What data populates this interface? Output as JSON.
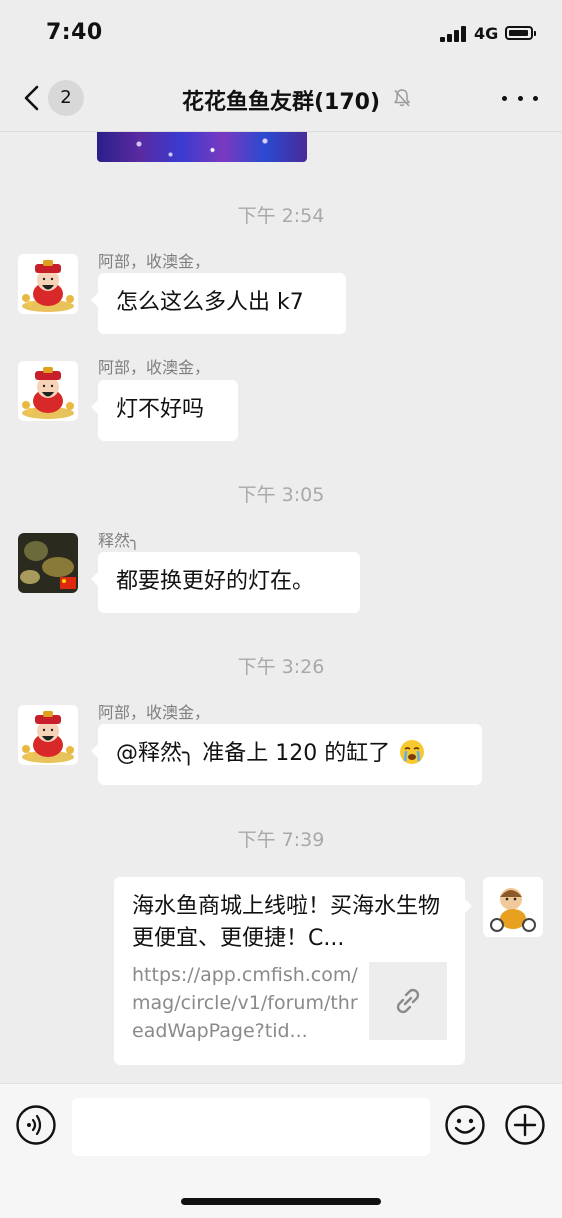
{
  "status_bar": {
    "time": "7:40",
    "network": "4G"
  },
  "nav": {
    "back_badge": "2",
    "title": "花花鱼鱼友群(170)"
  },
  "messages": [
    {
      "timestamp": "下午 2:54"
    },
    {
      "sender": "阿部，收澳金，",
      "text": "怎么这么多人出 k7"
    },
    {
      "sender": "阿部，收澳金，",
      "text": "灯不好吗"
    },
    {
      "timestamp": "下午 3:05"
    },
    {
      "sender": "释然╮",
      "text": "都要换更好的灯在。"
    },
    {
      "timestamp": "下午 3:26"
    },
    {
      "sender": "阿部，收澳金，",
      "text": "@释然╮  准备上 120 的缸了"
    },
    {
      "timestamp": "下午 7:39"
    },
    {
      "link_title": "海水鱼商城上线啦！买海水生物更便宜、更便捷！C...",
      "link_desc": "https://app.cmfish.com/mag/circle/v1/forum/threadWapPage?tid..."
    }
  ],
  "input": {
    "placeholder": ""
  },
  "colors": {
    "background": "#ededed",
    "bubble": "#ffffff",
    "timestamp": "#a9a9a9",
    "sender": "#7f7f7f"
  },
  "icons": [
    "back-icon",
    "mute-icon",
    "more-icon",
    "link-icon",
    "voice-icon",
    "emoji-icon",
    "plus-icon",
    "crying-emoji-icon"
  ]
}
